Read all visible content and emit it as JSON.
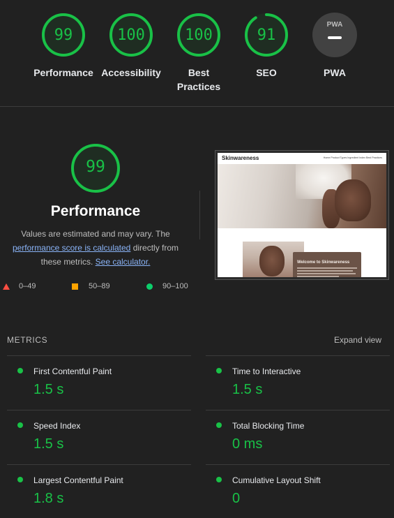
{
  "categories": [
    {
      "label": "Performance",
      "score": "99"
    },
    {
      "label": "Accessibility",
      "score": "100"
    },
    {
      "label": "Best Practices",
      "score": "100"
    },
    {
      "label": "SEO",
      "score": "91"
    },
    {
      "label": "PWA",
      "badge": "PWA"
    }
  ],
  "summary": {
    "score": "99",
    "title": "Performance",
    "desc_1": "Values are estimated and may vary. The",
    "link_1": "performance score is calculated",
    "desc_2": " directly from",
    "desc_3": "these metrics. ",
    "link_2": "See calculator."
  },
  "legend": [
    {
      "range": "0–49",
      "color": "#ff4e42"
    },
    {
      "range": "50–89",
      "color": "#ffa400"
    },
    {
      "range": "90–100",
      "color": "#0cce6b"
    }
  ],
  "thumbnail": {
    "logo": "Skinwareness",
    "links": "Home   Product Types   Ingredient Index   Best Practices",
    "card_title": "Welcome to Skinwareness"
  },
  "metrics": {
    "heading": "METRICS",
    "expand_label": "Expand view",
    "items": [
      {
        "name": "First Contentful Paint",
        "value": "1.5 s"
      },
      {
        "name": "Time to Interactive",
        "value": "1.5 s"
      },
      {
        "name": "Speed Index",
        "value": "1.5 s"
      },
      {
        "name": "Total Blocking Time",
        "value": "0 ms"
      },
      {
        "name": "Largest Contentful Paint",
        "value": "1.8 s"
      },
      {
        "name": "Cumulative Layout Shift",
        "value": "0"
      }
    ]
  },
  "colors": {
    "pass": "#19c147",
    "background": "#212121",
    "link": "#8ab4f8"
  }
}
